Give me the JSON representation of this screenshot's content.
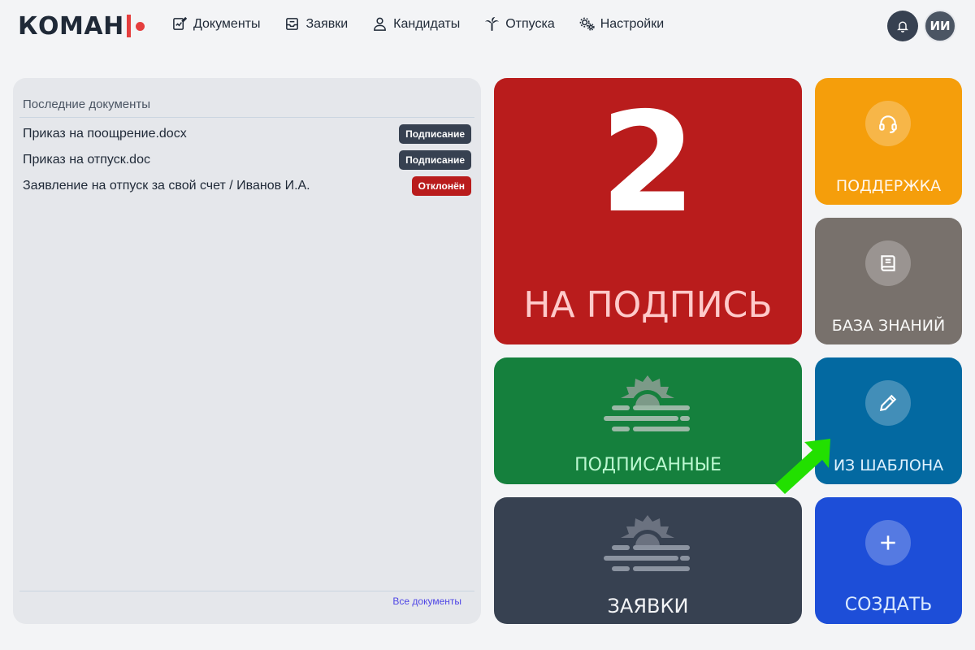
{
  "header": {
    "logo_text": "КОМАН",
    "nav": [
      {
        "label": "Документы",
        "icon": "document-edit-icon"
      },
      {
        "label": "Заявки",
        "icon": "inbox-icon"
      },
      {
        "label": "Кандидаты",
        "icon": "user-icon"
      },
      {
        "label": "Отпуска",
        "icon": "palm-tree-icon"
      },
      {
        "label": "Настройки",
        "icon": "gears-icon"
      }
    ],
    "notifications_icon": "bell-icon",
    "avatar_initials": "ИИ"
  },
  "recent_docs": {
    "title": "Последние документы",
    "items": [
      {
        "name": "Приказ на поощрение.docx",
        "status": "Подписание",
        "status_color": "#374151"
      },
      {
        "name": "Приказ на отпуск.doc",
        "status": "Подписание",
        "status_color": "#374151"
      },
      {
        "name": "Заявление на отпуск за свой счет / Иванов И.А.",
        "status": "Отклонён",
        "status_color": "#b91c1c"
      }
    ],
    "all_link": "Все документы"
  },
  "tiles": {
    "to_sign": {
      "count": "2",
      "label": "НА ПОДПИСЬ",
      "color": "#b91c1c"
    },
    "signed": {
      "label": "ПОДПИСАННЫЕ",
      "color": "#15803d",
      "icon": "sunrise-icon"
    },
    "requests": {
      "label": "ЗАЯВКИ",
      "color": "#374151",
      "icon": "sunrise-icon"
    },
    "support": {
      "label": "ПОДДЕРЖКА",
      "color": "#f59e0b",
      "icon": "headset-icon"
    },
    "knowledge_base": {
      "label": "БАЗА ЗНАНИЙ",
      "color": "#78716c",
      "icon": "book-icon"
    },
    "from_template": {
      "label": "ИЗ ШАБЛОНА",
      "color": "#0369a1",
      "icon": "pencil-icon"
    },
    "create": {
      "label": "СОЗДАТЬ",
      "color": "#1d4ed8",
      "icon": "plus-icon"
    }
  },
  "annotation": {
    "icon": "green-arrow-icon",
    "color": "#22e000"
  }
}
